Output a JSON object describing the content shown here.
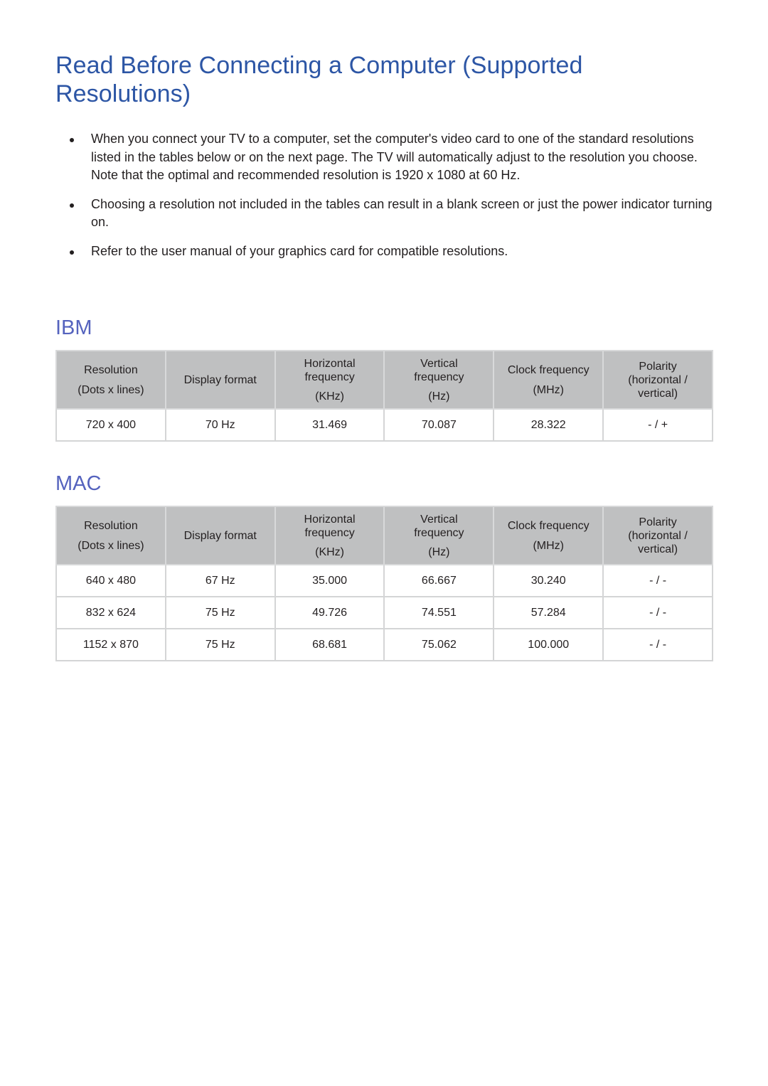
{
  "page": {
    "title": "Read Before Connecting a Computer (Supported Resolutions)",
    "bullets": [
      "When you connect your TV to a computer, set the computer's video card to one of the standard resolutions listed in the tables below or on the next page. The TV will automatically adjust to the resolution you choose. Note that the optimal and recommended resolution is 1920 x 1080 at 60 Hz.",
      "Choosing a resolution not included in the tables can result in a blank screen or just the power indicator turning on.",
      "Refer to the user manual of your graphics card for compatible resolutions."
    ]
  },
  "columns": {
    "resolution": {
      "line1": "Resolution",
      "line2": "(Dots x lines)"
    },
    "display_format": {
      "line1": "Display format"
    },
    "horizontal": {
      "line1": "Horizontal",
      "line2": "frequency",
      "unit": "(KHz)"
    },
    "vertical": {
      "line1": "Vertical",
      "line2": "frequency",
      "unit": "(Hz)"
    },
    "clock": {
      "line1": "Clock frequency",
      "unit": "(MHz)"
    },
    "polarity": {
      "line1": "Polarity",
      "line2": "(horizontal /",
      "line3": "vertical)"
    }
  },
  "ibm": {
    "heading": "IBM",
    "rows": [
      {
        "resolution": "720 x 400",
        "display_format": "70 Hz",
        "horizontal": "31.469",
        "vertical": "70.087",
        "clock": "28.322",
        "polarity": "- / +"
      }
    ]
  },
  "mac": {
    "heading": "MAC",
    "rows": [
      {
        "resolution": "640 x 480",
        "display_format": "67 Hz",
        "horizontal": "35.000",
        "vertical": "66.667",
        "clock": "30.240",
        "polarity": "- / -"
      },
      {
        "resolution": "832 x 624",
        "display_format": "75 Hz",
        "horizontal": "49.726",
        "vertical": "74.551",
        "clock": "57.284",
        "polarity": "- / -"
      },
      {
        "resolution": "1152 x 870",
        "display_format": "75 Hz",
        "horizontal": "68.681",
        "vertical": "75.062",
        "clock": "100.000",
        "polarity": "- / -"
      }
    ]
  }
}
